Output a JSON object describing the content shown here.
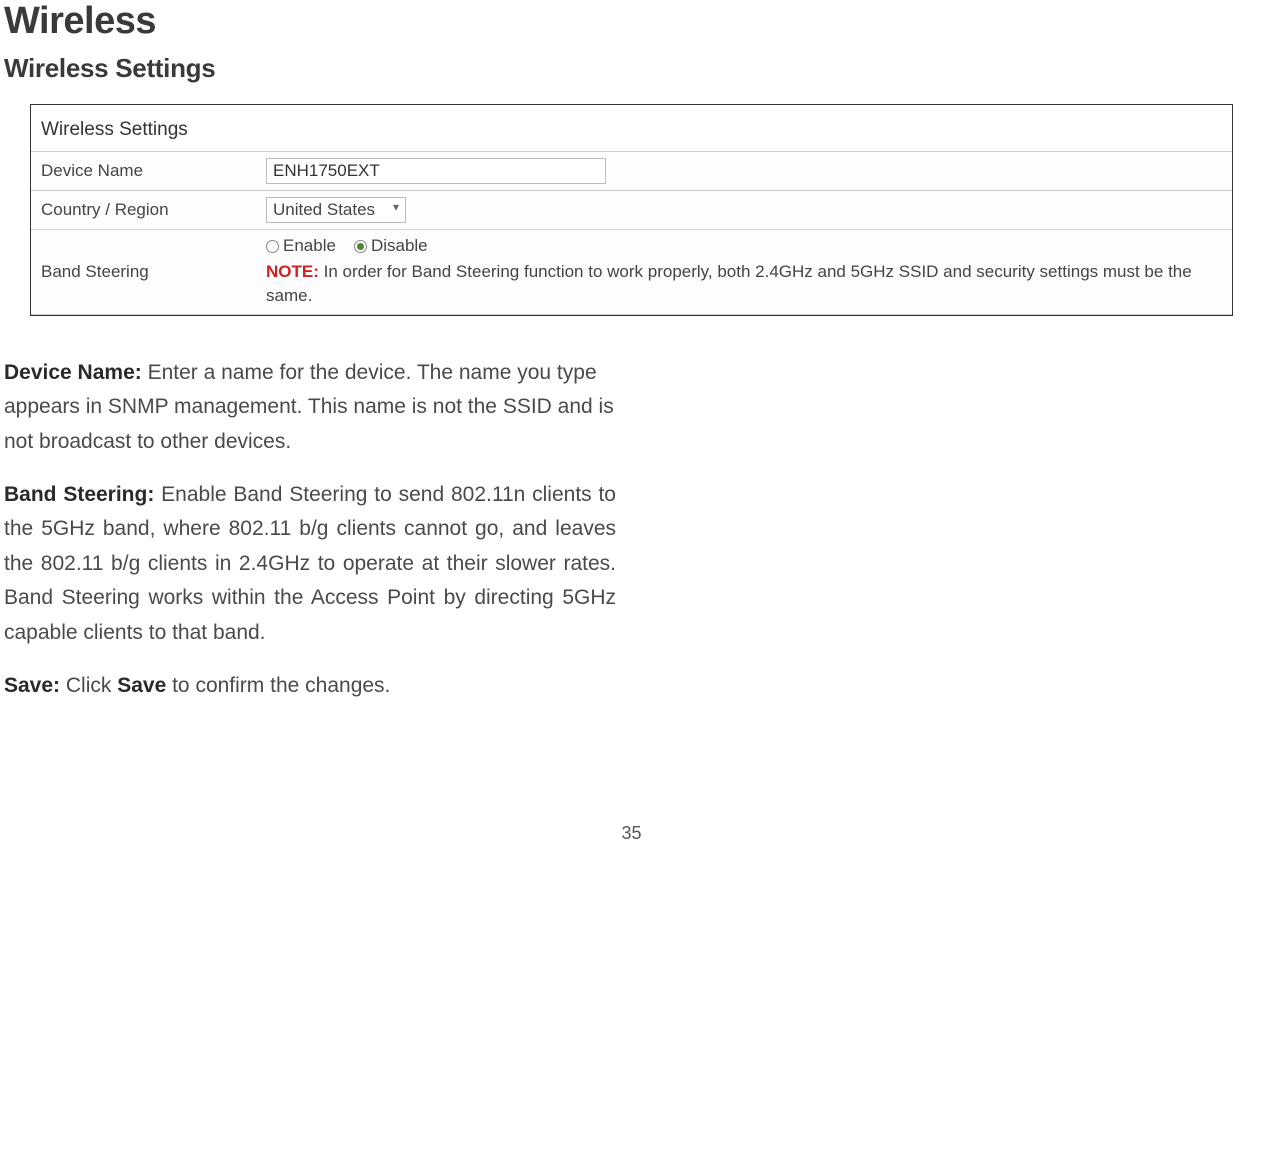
{
  "page": {
    "title": "Wireless",
    "section_title": "Wireless Settings",
    "page_number": "35"
  },
  "settings_box": {
    "heading": "Wireless Settings",
    "rows": {
      "device_name": {
        "label": "Device Name",
        "value": "ENH1750EXT"
      },
      "country_region": {
        "label": "Country / Region",
        "selected": "United States"
      },
      "band_steering": {
        "label": "Band Steering",
        "options": {
          "enable": "Enable",
          "disable": "Disable"
        },
        "selected": "disable",
        "note_label": "NOTE:",
        "note_text": "In order for Band Steering function to work properly, both 2.4GHz and 5GHz SSID and security settings must be the same."
      }
    }
  },
  "descriptions": {
    "device_name": {
      "label": "Device Name:",
      "text": " Enter a name for the device. The name you type appears in SNMP management. This name is not the SSID and is not broadcast to other devices."
    },
    "band_steering": {
      "label": "Band Steering:",
      "text": " Enable Band Steering to send 802.11n clients to the 5GHz band, where 802.11 b/g clients cannot go, and leaves the 802.11 b/g clients in 2.4GHz to operate at their slower rates. Band Steering works within the Access Point by directing 5GHz capable clients to that band."
    },
    "save": {
      "label": "Save:",
      "text_prefix": " Click ",
      "bold_word": "Save",
      "text_suffix": " to confirm the changes."
    }
  }
}
